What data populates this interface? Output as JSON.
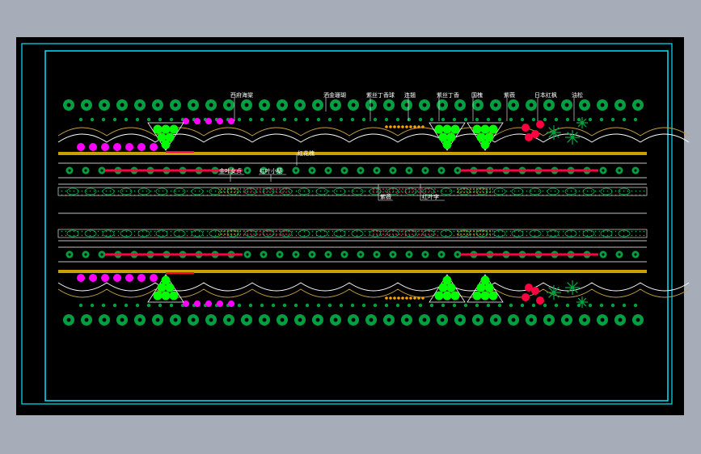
{
  "colors": {
    "background": "#000000",
    "frame": "#00ffff",
    "outer": "#a7adb8",
    "tree": "#00a040",
    "shrub": "#00ff00",
    "magenta": "#ff00ff",
    "red": "#ff0040",
    "orange": "#ffa500",
    "yellow": "#ffff00",
    "line": "#ffffff"
  },
  "labels": [
    {
      "id": "l1",
      "text": "西府海棠"
    },
    {
      "id": "l2",
      "text": "洒金珊瑚"
    },
    {
      "id": "l3",
      "text": "紫丝丁香球"
    },
    {
      "id": "l4",
      "text": "连翘"
    },
    {
      "id": "l5",
      "text": "紫丝丁香"
    },
    {
      "id": "l6",
      "text": "国槐"
    },
    {
      "id": "l7",
      "text": "紫薇"
    },
    {
      "id": "l8",
      "text": "日本红枫"
    },
    {
      "id": "l9",
      "text": "油松"
    },
    {
      "id": "l10",
      "text": "红花槐"
    },
    {
      "id": "l11",
      "text": "金叶女贞"
    },
    {
      "id": "l12",
      "text": "红叶小檗"
    },
    {
      "id": "l13",
      "text": "紫薇"
    },
    {
      "id": "l14",
      "text": "红叶李"
    }
  ]
}
